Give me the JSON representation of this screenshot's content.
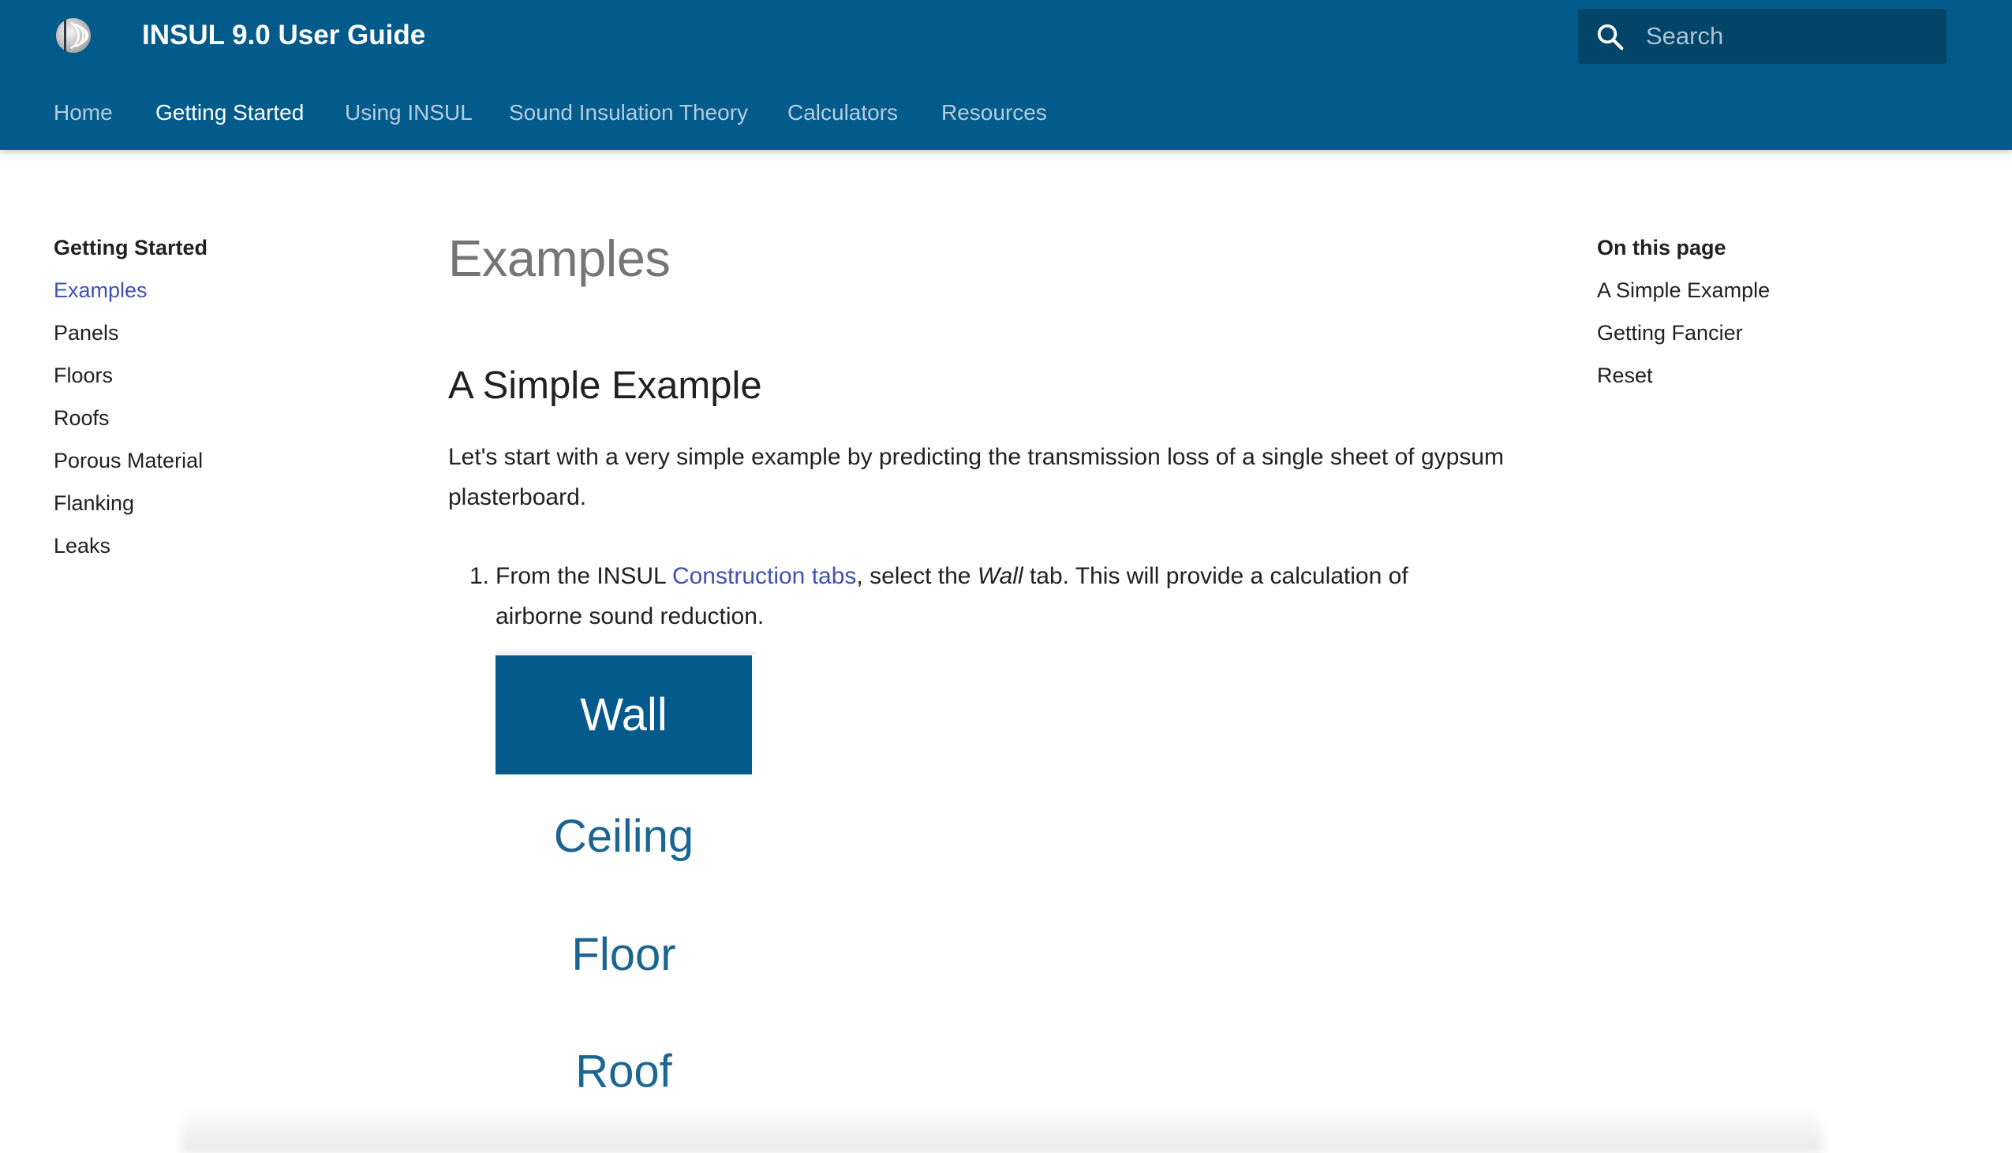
{
  "header": {
    "site_title": "INSUL 9.0 User Guide",
    "logo_icon": "insul-logo-icon",
    "search": {
      "placeholder": "Search",
      "value": "",
      "icon": "search-icon"
    },
    "tabs": [
      {
        "label": "Home",
        "active": false
      },
      {
        "label": "Getting Started",
        "active": true
      },
      {
        "label": "Using INSUL",
        "active": false
      },
      {
        "label": "Sound Insulation Theory",
        "active": false
      },
      {
        "label": "Calculators",
        "active": false
      },
      {
        "label": "Resources",
        "active": false
      }
    ]
  },
  "sidebar": {
    "heading": "Getting Started",
    "items": [
      {
        "label": "Examples",
        "active": true
      },
      {
        "label": "Panels"
      },
      {
        "label": "Floors"
      },
      {
        "label": "Roofs"
      },
      {
        "label": "Porous Material"
      },
      {
        "label": "Flanking"
      },
      {
        "label": "Leaks"
      }
    ]
  },
  "toc": {
    "heading": "On this page",
    "items": [
      {
        "label": "A Simple Example"
      },
      {
        "label": "Getting Fancier"
      },
      {
        "label": "Reset"
      }
    ]
  },
  "content": {
    "title": "Examples",
    "section_heading": "A Simple Example",
    "intro": "Let's start with a very simple example by predicting the transmission loss of a single sheet of gypsum plasterboard.",
    "steps": [
      {
        "number": "1.",
        "before_link": "From the INSUL ",
        "link": "Construction tabs",
        "after_link": ", select the ",
        "emphasis": "Wall",
        "after_emphasis": " tab. This will provide a calculation of airborne sound reduction."
      }
    ],
    "construction_tabs_image": {
      "selected": "Wall",
      "labels": [
        "Wall",
        "Ceiling",
        "Floor",
        "Roof"
      ]
    }
  },
  "colors": {
    "header_bg": "#035b8b",
    "search_bg": "#024569",
    "link": "#3f51b5",
    "tab_selected_bg": "#045a8b",
    "tab_text": "#1b6591"
  }
}
